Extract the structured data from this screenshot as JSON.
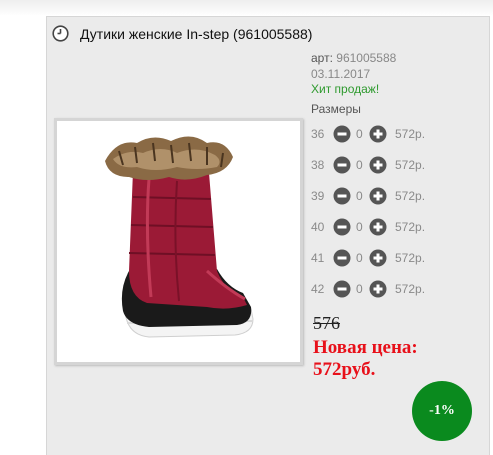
{
  "product": {
    "title": "Дутики женские In-step (961005588)",
    "art_label": "арт:",
    "art_value": "961005588",
    "date": "03.11.2017",
    "hit": "Хит продаж!",
    "image_alt": "winter-boot"
  },
  "sizes": {
    "label": "Размеры",
    "rows": [
      {
        "size": "36",
        "qty": "0",
        "price": "572р."
      },
      {
        "size": "38",
        "qty": "0",
        "price": "572р."
      },
      {
        "size": "39",
        "qty": "0",
        "price": "572р."
      },
      {
        "size": "40",
        "qty": "0",
        "price": "572р."
      },
      {
        "size": "41",
        "qty": "0",
        "price": "572р."
      },
      {
        "size": "42",
        "qty": "0",
        "price": "572р."
      }
    ]
  },
  "pricing": {
    "old_price": "576",
    "new_price_label": "Новая цена:",
    "new_price": "572руб.",
    "discount": "-1%"
  },
  "colors": {
    "hit": "#2e9a2e",
    "new_price": "#e8101a",
    "badge": "#0a8a1e",
    "boot": "#9b1a36"
  }
}
